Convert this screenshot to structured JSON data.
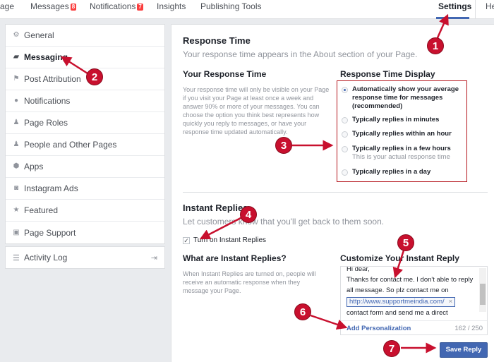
{
  "topnav": {
    "tabs": [
      {
        "label": "age"
      },
      {
        "label": "Messages",
        "badge": "8"
      },
      {
        "label": "Notifications",
        "badge": "7"
      },
      {
        "label": "Insights"
      },
      {
        "label": "Publishing Tools"
      }
    ],
    "settings": "Settings",
    "help": "He"
  },
  "sidebar": {
    "items": [
      {
        "label": "General",
        "icon": "gear-icon"
      },
      {
        "label": "Messaging",
        "icon": "chat-bubbles-icon"
      },
      {
        "label": "Post Attribution",
        "icon": "flag-icon"
      },
      {
        "label": "Notifications",
        "icon": "globe-icon"
      },
      {
        "label": "Page Roles",
        "icon": "person-icon"
      },
      {
        "label": "People and Other Pages",
        "icon": "people-icon"
      },
      {
        "label": "Apps",
        "icon": "cube-icon"
      },
      {
        "label": "Instagram Ads",
        "icon": "instagram-icon"
      },
      {
        "label": "Featured",
        "icon": "star-icon"
      },
      {
        "label": "Page Support",
        "icon": "facebook-icon"
      }
    ],
    "activity_log": "Activity Log"
  },
  "response_time": {
    "title": "Response Time",
    "subtitle": "Your response time appears in the About section of your Page.",
    "your_heading": "Your Response Time",
    "your_desc": "Your response time will only be visible on your Page if you visit your Page at least once a week and answer 90% or more of your messages. You can choose the option you think best represents how quickly you reply to messages, or have your response time updated automatically.",
    "display_heading": "Response Time Display",
    "options": [
      {
        "label": "Automatically show your average response time for messages (recommended)",
        "selected": true
      },
      {
        "label": "Typically replies in minutes",
        "selected": false
      },
      {
        "label": "Typically replies within an hour",
        "selected": false
      },
      {
        "label": "Typically replies in a few hours",
        "note": "This is your actual response time",
        "selected": false
      },
      {
        "label": "Typically replies in a day",
        "selected": false
      }
    ]
  },
  "instant_replies": {
    "title": "Instant Replies",
    "subtitle": "Let customers know that you'll get back to them soon.",
    "checkbox_label": "Turn on Instant Replies",
    "checkbox_checked": true,
    "what_heading": "What are Instant Replies?",
    "what_desc": "When Instant Replies are turned on, people will receive an automatic response when they message your Page.",
    "customize_heading": "Customize Your Instant Reply",
    "reply_lines": [
      "Hi dear,",
      "Thanks for contact me. I don't able to reply all message. So plz contact me on"
    ],
    "link_token": "http://www.supportmeindia.com/",
    "reply_tail": "contact form and send me a direct message.",
    "add_personalization": "Add Personalization",
    "char_count": "162 / 250",
    "save_button": "Save Reply"
  },
  "annotations": [
    "1",
    "2",
    "3",
    "4",
    "5",
    "6",
    "7"
  ],
  "colors": {
    "accent": "#4267b2",
    "annotation": "#c8102e",
    "badge": "#fa3e3e"
  }
}
